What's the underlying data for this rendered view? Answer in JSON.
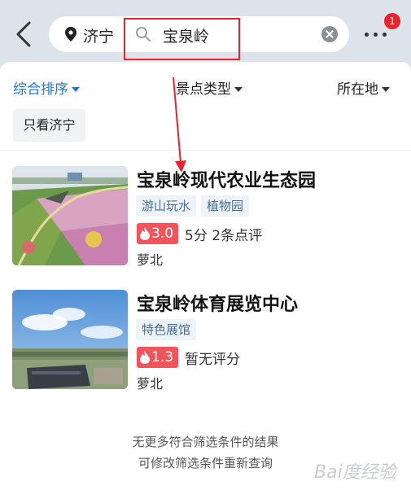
{
  "header": {
    "city": "济宁",
    "query": "宝泉岭",
    "notification_count": "1"
  },
  "filters": {
    "sort": "综合排序",
    "category": "景点类型",
    "location": "所在地",
    "chip": "只看济宁"
  },
  "results": [
    {
      "title": "宝泉岭现代农业生态园",
      "tags": [
        "游山玩水",
        "植物园"
      ],
      "heat": "3.0",
      "rating": "5分 2条点评",
      "district": "萝北"
    },
    {
      "title": "宝泉岭体育展览中心",
      "tags": [
        "特色展馆"
      ],
      "heat": "1.3",
      "rating": "暂无评分",
      "district": "萝北"
    }
  ],
  "footer": {
    "line1": "无更多符合筛选条件的结果",
    "line2": "可修改筛选条件重新查询"
  },
  "watermark": "Bai度经验",
  "colors": {
    "accent": "#1677e6",
    "heat_badge": "#f2545b",
    "annotation_red": "#e8232b"
  }
}
